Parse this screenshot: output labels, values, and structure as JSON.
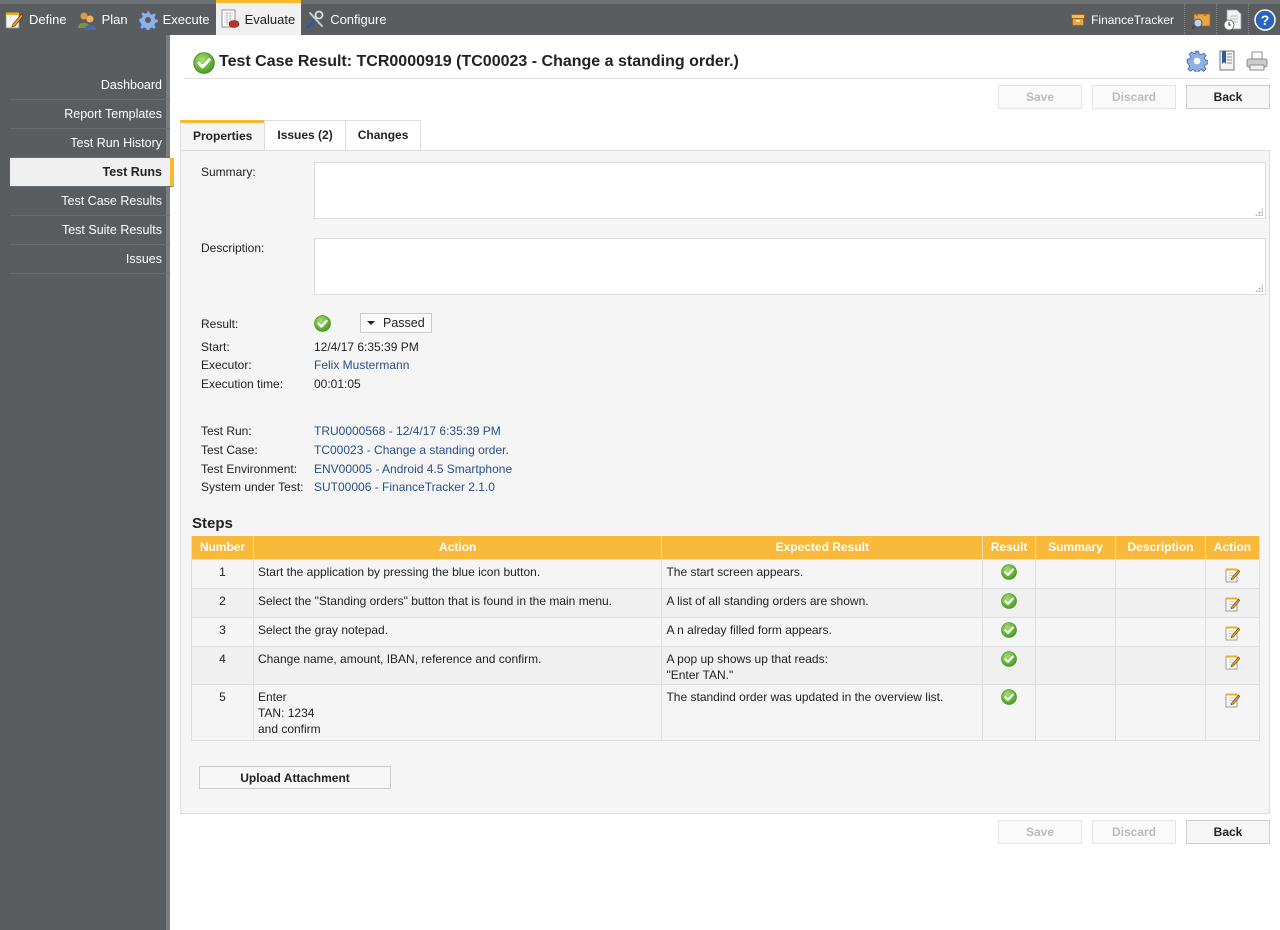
{
  "topnav": {
    "items": [
      {
        "label": "Define",
        "icon": "notepad-pencil-icon"
      },
      {
        "label": "Plan",
        "icon": "users-icon"
      },
      {
        "label": "Execute",
        "icon": "gear-icon"
      },
      {
        "label": "Evaluate",
        "icon": "report-chart-icon",
        "active": true
      },
      {
        "label": "Configure",
        "icon": "tools-icon"
      }
    ],
    "project": "FinanceTracker",
    "right_icons": [
      "box-search-icon",
      "document-clock-icon",
      "help-icon"
    ]
  },
  "sidebar": {
    "items": [
      {
        "label": "Dashboard"
      },
      {
        "label": "Report Templates"
      },
      {
        "label": "Test Run History"
      },
      {
        "label": "Test Runs",
        "active": true
      },
      {
        "label": "Test Case Results"
      },
      {
        "label": "Test Suite Results"
      },
      {
        "label": "Issues"
      }
    ]
  },
  "header": {
    "title": "Test Case Result: TCR0000919 (TC00023 - Change a standing order.)",
    "icons": [
      "settings-icon",
      "bookmark-icon",
      "print-icon"
    ]
  },
  "buttons": {
    "save": "Save",
    "discard": "Discard",
    "back": "Back",
    "upload": "Upload Attachment"
  },
  "tabs": [
    {
      "label": "Properties",
      "active": true
    },
    {
      "label": "Issues (2)"
    },
    {
      "label": "Changes"
    }
  ],
  "form": {
    "summary_label": "Summary:",
    "summary_value": "",
    "description_label": "Description:",
    "description_value": "",
    "result_label": "Result:",
    "result_value": "Passed",
    "start_label": "Start:",
    "start_value": "12/4/17 6:35:39 PM",
    "executor_label": "Executor:",
    "executor_value": "Felix Mustermann",
    "exec_time_label": "Execution time:",
    "exec_time_value": "00:01:05",
    "test_run_label": "Test Run:",
    "test_run_value": "TRU0000568 - 12/4/17 6:35:39 PM",
    "test_case_label": "Test Case:",
    "test_case_value": "TC00023 - Change a standing order.",
    "test_env_label": "Test Environment:",
    "test_env_value": "ENV00005 - Android 4.5 Smartphone",
    "sut_label": "System under Test:",
    "sut_value": "SUT00006 - FinanceTracker 2.1.0"
  },
  "steps": {
    "title": "Steps",
    "columns": [
      "Number",
      "Action",
      "Expected Result",
      "Result",
      "Summary",
      "Description",
      "Action"
    ],
    "rows": [
      {
        "number": "1",
        "action": "Start the application by pressing the blue icon button.",
        "expected": "The start screen appears.",
        "result": "passed",
        "summary": "",
        "description": ""
      },
      {
        "number": "2",
        "action": "Select the \"Standing orders\" button that is found in the main menu.",
        "expected": "A list of all standing orders are shown.",
        "result": "passed",
        "summary": "",
        "description": ""
      },
      {
        "number": "3",
        "action": "Select the gray notepad.",
        "expected": "A n alreday filled form appears.",
        "result": "passed",
        "summary": "",
        "description": ""
      },
      {
        "number": "4",
        "action": "Change name, amount, IBAN, reference and confirm.",
        "expected": "A pop up shows up that reads:\n\"Enter TAN.\"",
        "result": "passed",
        "summary": "",
        "description": ""
      },
      {
        "number": "5",
        "action": "Enter\nTAN: 1234\nand confirm",
        "expected": "The standind order was updated in the overview list.",
        "result": "passed",
        "summary": "",
        "description": ""
      }
    ]
  },
  "colors": {
    "accent": "#f9b92c",
    "nav_bg": "#5a5d60",
    "link": "#2a4f8c",
    "pass": "#5cb531"
  }
}
